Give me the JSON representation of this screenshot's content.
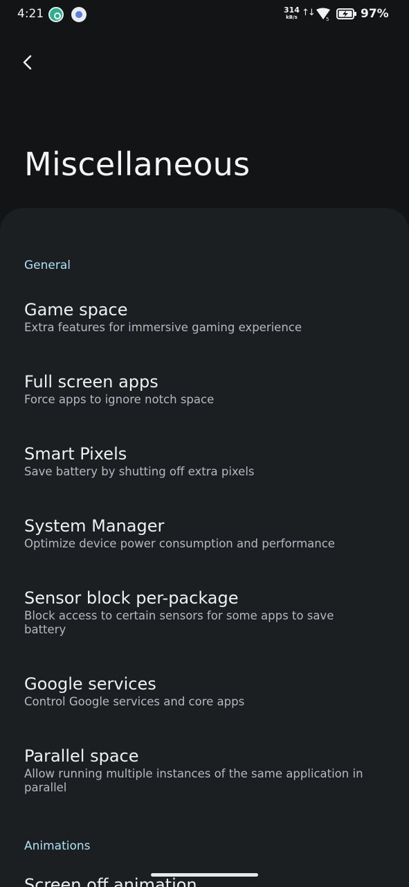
{
  "status_bar": {
    "time": "4:21",
    "speed_value": "314",
    "speed_unit": "kB/s",
    "network_tag": "5",
    "battery_percent": "97%",
    "icons": [
      "app-notification-icon",
      "settings-app-icon",
      "data-arrows-icon",
      "wifi-signal-icon",
      "battery-charging-icon"
    ]
  },
  "header": {
    "back_icon": "chevron-left-icon",
    "title": "Miscellaneous"
  },
  "sections": [
    {
      "header": "General",
      "items": [
        {
          "title": "Game space",
          "summary": "Extra features for immersive gaming experience"
        },
        {
          "title": "Full screen apps",
          "summary": "Force apps to ignore notch space"
        },
        {
          "title": "Smart Pixels",
          "summary": "Save battery by shutting off extra pixels"
        },
        {
          "title": "System Manager",
          "summary": "Optimize device power consumption and performance"
        },
        {
          "title": "Sensor block per-package",
          "summary": "Block access to certain sensors for some apps to save battery"
        },
        {
          "title": "Google services",
          "summary": "Control Google services and core apps"
        },
        {
          "title": "Parallel space",
          "summary": "Allow running multiple instances of the same application in parallel"
        }
      ]
    },
    {
      "header": "Animations",
      "items": [
        {
          "title": "Screen off animation",
          "summary": ""
        }
      ]
    }
  ],
  "colors": {
    "background": "#121416",
    "card": "#1b1f22",
    "section_header": "#aee2f4",
    "title_text": "#eef0f2",
    "summary_text": "#b6babe"
  }
}
